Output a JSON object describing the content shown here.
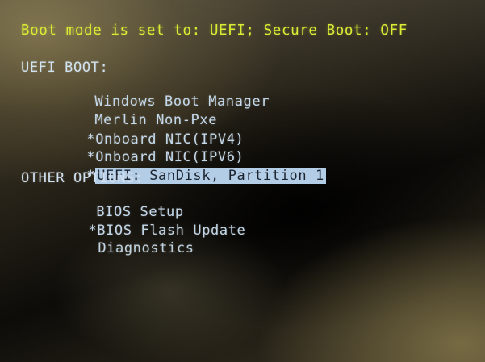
{
  "status_line": "Boot mode is set to: UEFI; Secure Boot: OFF",
  "uefi_boot": {
    "heading": "UEFI BOOT:",
    "items": [
      {
        "marker": "",
        "label": "Windows Boot Manager"
      },
      {
        "marker": "",
        "label": "Merlin Non-Pxe"
      },
      {
        "marker": "*",
        "label": "Onboard NIC(IPV4)"
      },
      {
        "marker": "*",
        "label": "Onboard NIC(IPV6)"
      },
      {
        "marker": "*",
        "label": "UEFI: SanDisk, Partition 1"
      }
    ]
  },
  "other_options": {
    "heading": "OTHER OPTIONS:",
    "items": [
      {
        "marker": "",
        "label": "BIOS Setup"
      },
      {
        "marker": "*",
        "label": "BIOS Flash Update"
      },
      {
        "marker": "",
        "label": "Diagnostics"
      }
    ]
  },
  "colors": {
    "status_text": "#d8ec2c",
    "menu_text": "#c3d8ea",
    "highlight_bg": "#b4cde6",
    "highlight_text": "#1c2430"
  }
}
